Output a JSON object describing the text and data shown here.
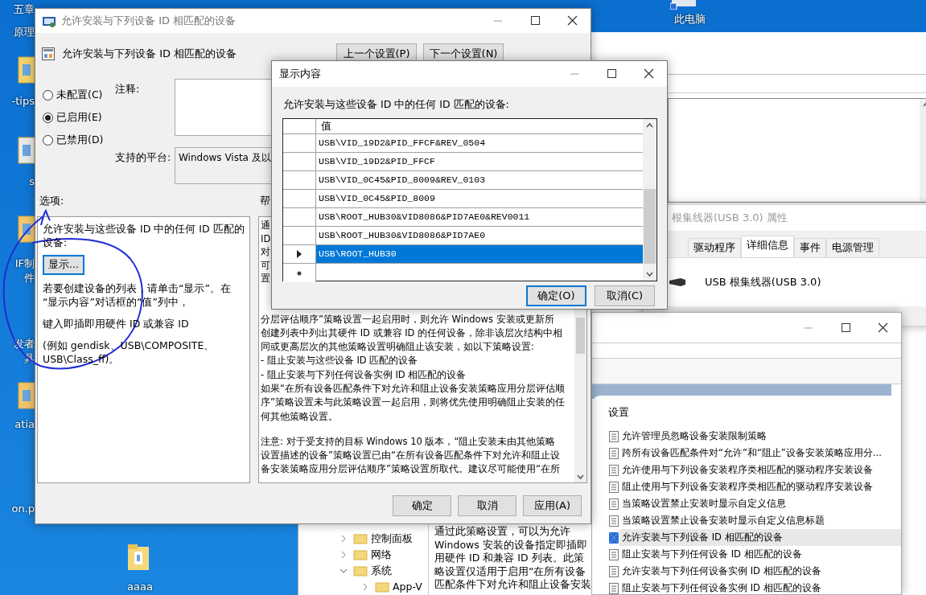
{
  "desktop": {
    "side_labels": [
      "五章",
      "原理",
      "-tips",
      "s",
      "IF制",
      "件",
      "发者",
      "具",
      "atia",
      "on.p"
    ],
    "this_pc": "此电脑",
    "folder": "aaaa"
  },
  "properties_window": {
    "title": "根集线器(USB 3.0) 属性",
    "tabs": [
      {
        "label": "驱动程序",
        "selected": false
      },
      {
        "label": "详细信息",
        "selected": true
      },
      {
        "label": "事件",
        "selected": false
      },
      {
        "label": "电源管理",
        "selected": false
      }
    ],
    "device_name": "USB 根集线器(USB 3.0)"
  },
  "policy_list_window": {
    "column_header": "设置",
    "items": [
      {
        "label": "允许管理员忽略设备安装限制策略",
        "selected": false
      },
      {
        "label": "跨所有设备匹配条件对“允许”和“阻止”设备安装策略应用分...",
        "selected": false
      },
      {
        "label": "允许使用与下列设备安装程序类相匹配的驱动程序安装设备",
        "selected": false
      },
      {
        "label": "阻止使用与下列设备安装程序类相匹配的驱动程序安装设备",
        "selected": false
      },
      {
        "label": "当策略设置禁止安装时显示自定义信息",
        "selected": false
      },
      {
        "label": "当策略设置禁止设备安装时显示自定义信息标题",
        "selected": false
      },
      {
        "label": "允许安装与下列设备 ID 相匹配的设备",
        "selected": true
      },
      {
        "label": "阻止安装与下列任何设备 ID 相匹配的设备",
        "selected": false
      },
      {
        "label": "允许安装与下列任何设备实例 ID 相匹配的设备",
        "selected": false
      },
      {
        "label": "阻止安装与下列任何设备实例 ID 相匹配的设备",
        "selected": false
      }
    ]
  },
  "policy_editor": {
    "tree": [
      {
        "label": "控制面板",
        "expanded": false
      },
      {
        "label": "网络",
        "expanded": false
      },
      {
        "label": "系统",
        "expanded": true,
        "children": [
          {
            "label": "App-V",
            "expanded": false
          }
        ]
      }
    ],
    "description_lines": [
      "通过此策略设置，可以为允许",
      "Windows 安装的设备指定即插即",
      "用硬件 ID 和兼容 ID 列表。此策",
      "略设置仅适用于启用“在所有设备",
      "匹配条件下对允许和阻止设备安装"
    ]
  },
  "main_dialog": {
    "title": "允许安装与下列设备 ID 相匹配的设备",
    "header": "允许安装与下列设备 ID 相匹配的设备",
    "nav_buttons": [
      "上一个设置(P)",
      "下一个设置(N)"
    ],
    "radios": [
      {
        "label": "未配置(C)",
        "selected": false
      },
      {
        "label": "已启用(E)",
        "selected": true
      },
      {
        "label": "已禁用(D)",
        "selected": false
      }
    ],
    "comment_label": "注释:",
    "platform_label": "支持的平台:",
    "platform_value": "Windows Vista 及以",
    "options_label": "选项:",
    "help_label": "帮",
    "options": {
      "prompt": "允许安装与这些设备 ID 中的任何 ID 匹配的设备:",
      "show_button": "显示...",
      "paragraphs": [
        "若要创建设备的列表，请单击“显示”。在 “显示内容”对话框的“值”列中，",
        "键入即插即用硬件 ID 或兼容 ID",
        "(例如 gendisk、USB\\COMPOSITE、USB\\Class_ff)。"
      ]
    },
    "help": {
      "fragments": [
        "通",
        "ID",
        "对",
        "可",
        "置"
      ],
      "lines": [
        "分层评估顺序”策略设置一起启用时，则允许 Windows 安装或更新所",
        "创建列表中列出其硬件 ID 或兼容 ID 的任何设备，除非该层次结构中相",
        "同或更高层次的其他策略设置明确阻止该安装，如以下策略设置:",
        "- 阻止安装与这些设备 ID 匹配的设备",
        "- 阻止安装与下列任何设备实例 ID 相匹配的设备",
        "如果“在所有设备匹配条件下对允许和阻止设备安装策略应用分层评估顺",
        "序”策略设置未与此策略设置一起启用，则将优先使用明确阻止安装的任",
        "何其他策略设置。"
      ],
      "note_lines": [
        "注意: 对于受支持的目标 Windows 10 版本，“阻止安装未由其他策略",
        "设置描述的设备”策略设置已由“在所有设备匹配条件下对允许和阻止设",
        "备安装策略应用分层评估顺序”策略设置所取代。建议尽可能使用“在所"
      ]
    },
    "buttons": [
      "确定",
      "取消",
      "应用(A)"
    ]
  },
  "show_dialog": {
    "title": "显示内容",
    "prompt": "允许安装与这些设备 ID 中的任何 ID 匹配的设备:",
    "column_header": "值",
    "rows": [
      {
        "value": "USB\\VID_19D2&PID_FFCF&REV_0504",
        "selected": false
      },
      {
        "value": "USB\\VID_19D2&PID_FFCF",
        "selected": false
      },
      {
        "value": "USB\\VID_0C45&PID_8009&REV_0103",
        "selected": false
      },
      {
        "value": "USB\\VID_0C45&PID_8009",
        "selected": false
      },
      {
        "value": "USB\\ROOT_HUB30&VID8086&PID7AE0&REV0011",
        "selected": false
      },
      {
        "value": "USB\\ROOT_HUB30&VID8086&PID7AE0",
        "selected": false
      },
      {
        "value": "USB\\ROOT_HUB30",
        "selected": true
      }
    ],
    "buttons": [
      {
        "label": "确定(O)",
        "default": true
      },
      {
        "label": "取消(C)",
        "default": false
      }
    ]
  }
}
